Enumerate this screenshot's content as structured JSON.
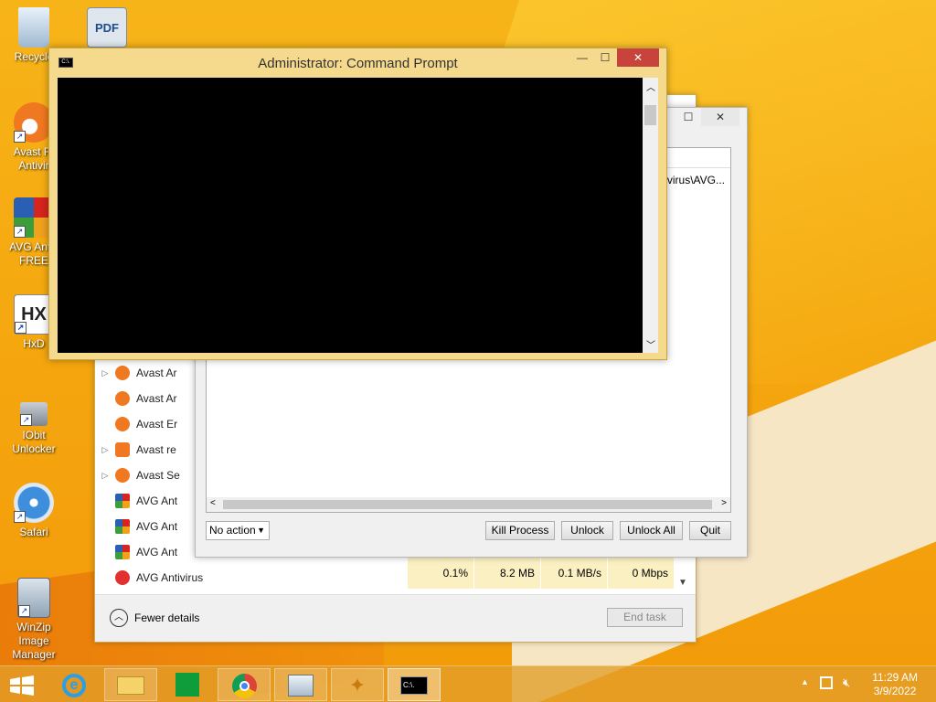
{
  "desktop": {
    "icons": [
      {
        "label": "Recycle",
        "icon": "recycle-bin-icon"
      },
      {
        "label": "PDF",
        "icon": "pdf-icon"
      },
      {
        "label": "Avast Fr Antivir",
        "icon": "avast-icon"
      },
      {
        "label": "AVG Antiv FREE",
        "icon": "avg-icon"
      },
      {
        "label": "HxD",
        "icon": "hxd-icon"
      },
      {
        "label": "IObit Unlocker",
        "icon": "iobit-unlocker-icon"
      },
      {
        "label": "Safari",
        "icon": "safari-icon"
      },
      {
        "label": "WinZip Image Manager",
        "icon": "winzip-image-icon"
      }
    ]
  },
  "cmd": {
    "title": "Administrator: Command Prompt",
    "icon_label": "C:\\.",
    "min": "—",
    "max": "☐",
    "close": "✕"
  },
  "unlocker": {
    "path": "ntivirus\\AVG...",
    "action_select": "No action",
    "buttons": {
      "kill": "Kill Process",
      "unlock": "Unlock",
      "unlock_all": "Unlock All",
      "quit": "Quit"
    }
  },
  "taskmgr": {
    "processes": [
      {
        "name": "Avast Ar",
        "expand": "▷"
      },
      {
        "name": "Avast Ar",
        "expand": ""
      },
      {
        "name": "Avast Er",
        "expand": ""
      },
      {
        "name": "Avast re",
        "expand": "▷"
      },
      {
        "name": "Avast Se",
        "expand": "▷"
      },
      {
        "name": "AVG Ant",
        "expand": ""
      },
      {
        "name": "AVG Ant",
        "expand": ""
      },
      {
        "name": "AVG Ant",
        "expand": ""
      }
    ],
    "selected": {
      "name": "AVG Antivirus",
      "cpu": "0.1%",
      "memory": "8.2 MB",
      "disk": "0.1 MB/s",
      "network": "0 Mbps"
    },
    "fewer_details": "Fewer details",
    "end_task": "End task"
  },
  "taskbar": {
    "time": "11:29 AM",
    "date": "3/9/2022"
  }
}
